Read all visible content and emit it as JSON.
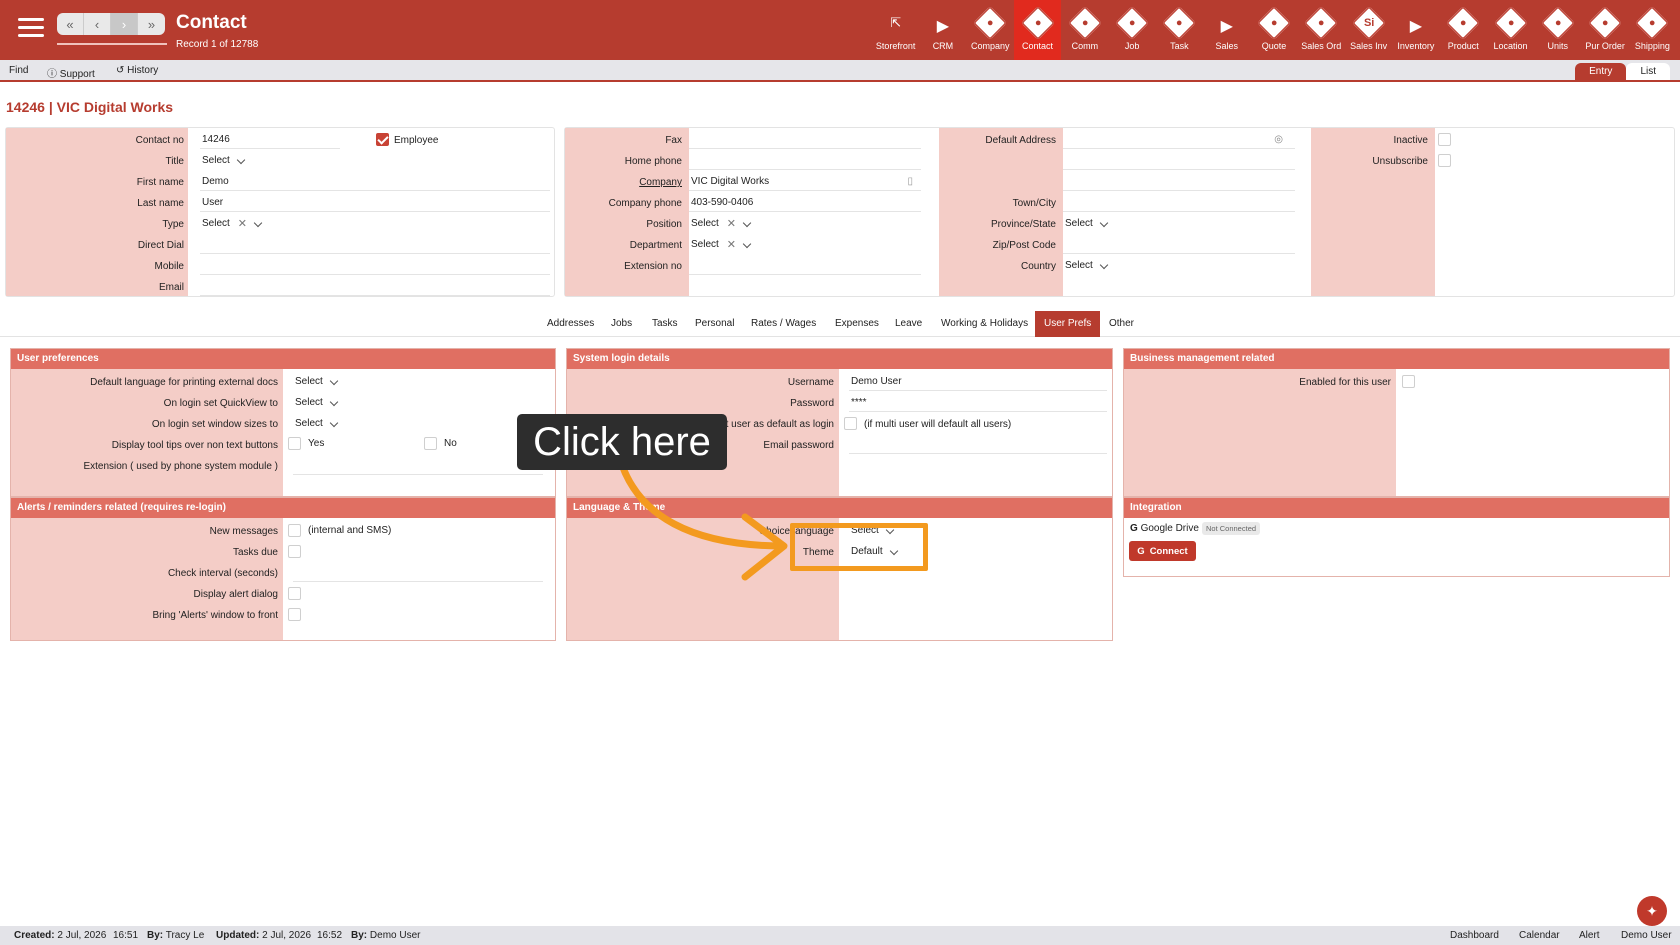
{
  "header": {
    "title": "Contact",
    "record_count": "Record 1 of 12788",
    "nav": [
      "«",
      "‹",
      "›",
      "»"
    ],
    "modules": [
      {
        "label": "Storefront",
        "icon": "external-link-icon"
      },
      {
        "label": "CRM",
        "icon": "arrow-right-icon"
      },
      {
        "label": "Company",
        "icon": "company-icon"
      },
      {
        "label": "Contact",
        "icon": "contact-icon",
        "active": true
      },
      {
        "label": "Comm",
        "icon": "comm-icon"
      },
      {
        "label": "Job",
        "icon": "job-icon"
      },
      {
        "label": "Task",
        "icon": "task-icon"
      },
      {
        "label": "Sales",
        "icon": "arrow-right-icon"
      },
      {
        "label": "Quote",
        "icon": "quote-icon"
      },
      {
        "label": "Sales Ord",
        "icon": "sales-order-icon"
      },
      {
        "label": "Sales Inv",
        "icon": "sales-invoice-icon",
        "glyph": "Si"
      },
      {
        "label": "Inventory",
        "icon": "arrow-right-icon"
      },
      {
        "label": "Product",
        "icon": "product-icon"
      },
      {
        "label": "Location",
        "icon": "location-icon"
      },
      {
        "label": "Units",
        "icon": "units-icon"
      },
      {
        "label": "Pur Order",
        "icon": "purchase-order-icon"
      },
      {
        "label": "Shipping",
        "icon": "shipping-icon"
      }
    ]
  },
  "toolbar": {
    "find": "Find",
    "support": "Support",
    "history": "History",
    "entry": "Entry",
    "list": "List"
  },
  "record": {
    "title": "14246 | VIC Digital Works"
  },
  "contact": {
    "contact_no_label": "Contact no",
    "contact_no": "14246",
    "employee_label": "Employee",
    "title_label": "Title",
    "title_value": "Select",
    "first_name_label": "First name",
    "first_name": "Demo",
    "last_name_label": "Last name",
    "last_name": "User",
    "type_label": "Type",
    "type_value": "Select",
    "direct_dial_label": "Direct Dial",
    "mobile_label": "Mobile",
    "email_label": "Email"
  },
  "company_info": {
    "fax_label": "Fax",
    "home_phone_label": "Home phone",
    "company_label": "Company",
    "company": "VIC Digital Works",
    "company_phone_label": "Company phone",
    "company_phone": "403-590-0406",
    "position_label": "Position",
    "position_value": "Select",
    "department_label": "Department",
    "department_value": "Select",
    "extension_label": "Extension no"
  },
  "address": {
    "default_address_label": "Default Address",
    "town_label": "Town/City",
    "province_label": "Province/State",
    "province_value": "Select",
    "zip_label": "Zip/Post Code",
    "country_label": "Country",
    "country_value": "Select"
  },
  "flags": {
    "inactive_label": "Inactive",
    "unsubscribe_label": "Unsubscribe"
  },
  "subtabs": [
    "Addresses",
    "Jobs",
    "Tasks",
    "Personal",
    "Rates / Wages",
    "Expenses",
    "Leave",
    "Working & Holidays",
    "User Prefs",
    "Other"
  ],
  "user_prefs": {
    "heading": "User preferences",
    "lang_label": "Default language for printing external docs",
    "lang_value": "Select",
    "quickview_label": "On login set QuickView to",
    "quickview_value": "Select",
    "window_label": "On login set window sizes to",
    "window_value": "Select",
    "tooltips_label": "Display tool tips over non text buttons",
    "yes": "Yes",
    "no": "No",
    "extension_label": "Extension ( used by phone system module )"
  },
  "alerts": {
    "heading": "Alerts / reminders related (requires re-login)",
    "new_messages_label": "New messages",
    "new_messages_note": "(internal and SMS)",
    "tasks_due_label": "Tasks due",
    "check_interval_label": "Check interval (seconds)",
    "display_alert_label": "Display alert dialog",
    "bring_front_label": "Bring 'Alerts' window to front"
  },
  "login": {
    "heading": "System login details",
    "username_label": "Username",
    "username": "Demo User",
    "password_label": "Password",
    "password": "****",
    "default_login_label": "Set user as default as login",
    "default_login_note": "(if multi user will default all users)",
    "email_password_label": "Email password"
  },
  "language": {
    "heading": "Language & Theme",
    "choice_label": "Choice language",
    "choice_value": "Select",
    "theme_label": "Theme",
    "theme_value": "Default"
  },
  "business": {
    "heading": "Business management related",
    "enabled_label": "Enabled for this user"
  },
  "integration": {
    "heading": "Integration",
    "google_drive": "Google Drive",
    "status": "Not Connected",
    "connect": "Connect"
  },
  "callout": {
    "text": "Click here",
    "accent_color": "#f39a1f"
  },
  "statusbar": {
    "created_label": "Created:",
    "created": "2 Jul, 2026",
    "created_time": "16:51",
    "created_by_label": "By:",
    "created_by": "Tracy Le",
    "updated_label": "Updated:",
    "updated": "2 Jul, 2026",
    "updated_time": "16:52",
    "updated_by_label": "By:",
    "updated_by": "Demo User",
    "links": [
      "Dashboard",
      "Calendar",
      "Alert",
      "Demo User"
    ]
  },
  "colors": {
    "brand": "#b63c2f",
    "active_module": "#e12a1e",
    "section_header": "#e06f62",
    "label_column": "#f4cdc7"
  }
}
